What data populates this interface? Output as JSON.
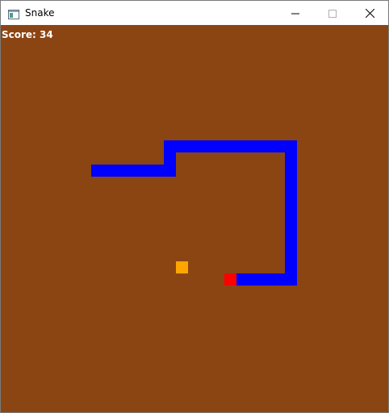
{
  "window": {
    "title": "Snake",
    "icon": "app-window-icon",
    "controls": [
      "minimize-icon",
      "maximize-icon",
      "close-icon"
    ]
  },
  "game": {
    "score_label": "Score: 34",
    "colors": {
      "background": "#8b4513",
      "snake_body": "#0000ff",
      "snake_head": "#ff0000",
      "food": "#ffa500",
      "score_text": "#ffffff"
    }
  }
}
